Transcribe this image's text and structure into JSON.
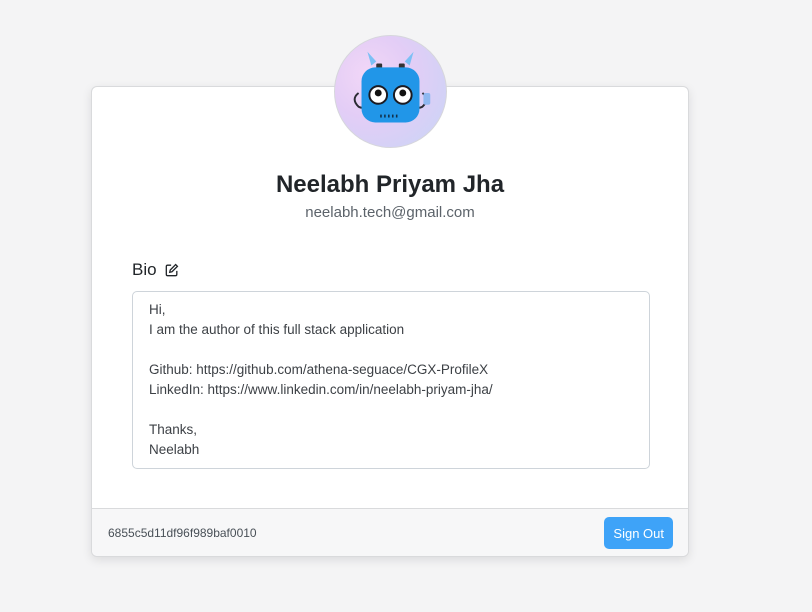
{
  "profile": {
    "name": "Neelabh Priyam Jha",
    "email": "neelabh.tech@gmail.com",
    "avatar_icon": "robot-avatar-icon"
  },
  "bio": {
    "label": "Bio",
    "edit_icon": "edit-icon",
    "text": "Hi,\nI am the author of this full stack application\n\nGithub: https://github.com/athena-seguace/CGX-ProfileX\nLinkedIn: https://www.linkedin.com/in/neelabh-priyam-jha/\n\nThanks,\nNeelabh"
  },
  "footer": {
    "user_id": "6855c5d11df96f989baf0010",
    "sign_out_label": "Sign Out"
  },
  "colors": {
    "background": "#f4f4f5",
    "primary_button": "#3ea3f8",
    "robot_body": "#2196e8"
  }
}
